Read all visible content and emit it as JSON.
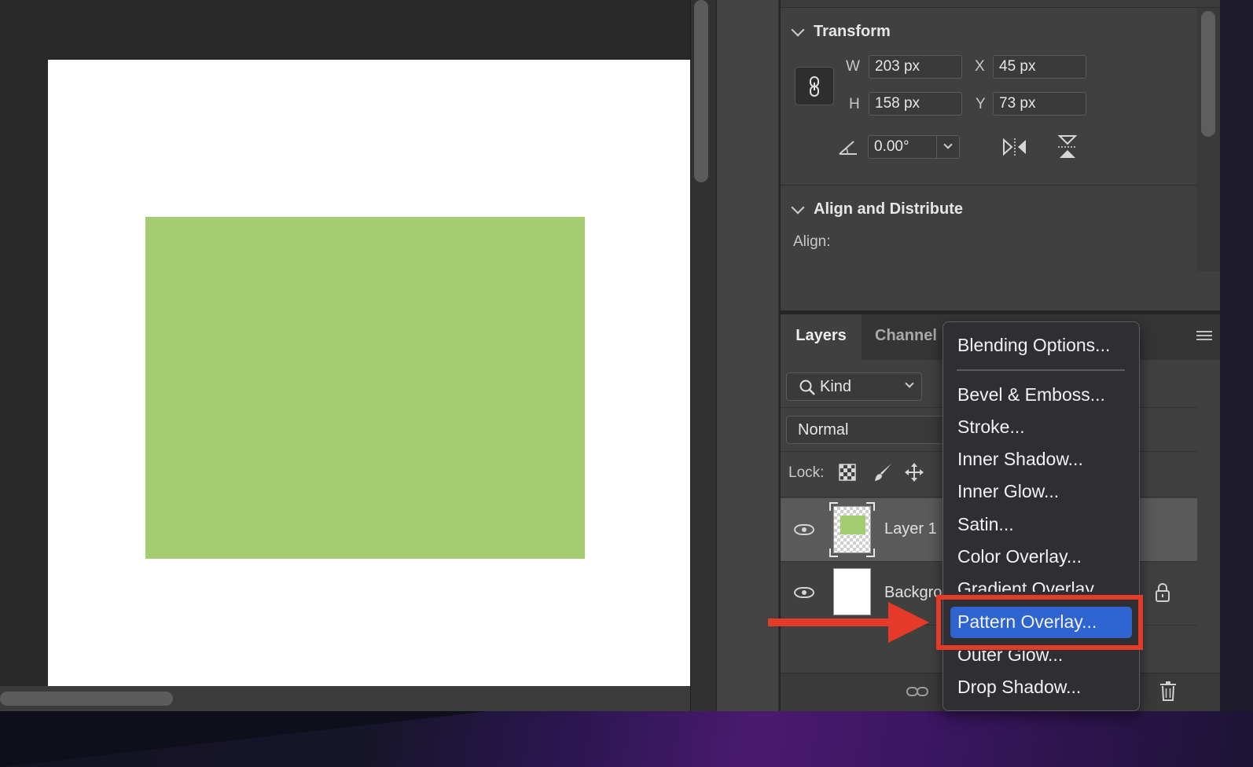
{
  "colors": {
    "layer_fill": "#a4cc71",
    "accent_red": "#e5392a",
    "menu_highlight": "#2e63d0"
  },
  "properties": {
    "transform": {
      "title": "Transform",
      "w_label": "W",
      "w_value": "203 px",
      "h_label": "H",
      "h_value": "158 px",
      "x_label": "X",
      "x_value": "45 px",
      "y_label": "Y",
      "y_value": "73 px",
      "angle_value": "0.00°"
    },
    "align": {
      "title": "Align and Distribute",
      "align_label": "Align:"
    }
  },
  "layers_panel": {
    "tabs": [
      "Layers",
      "Channel"
    ],
    "filter": "Kind",
    "blend_mode": "Normal",
    "lock_label": "Lock:",
    "layers": [
      {
        "name": "Layer 1",
        "selected": true
      },
      {
        "name": "Backgro",
        "selected": false
      }
    ]
  },
  "context_menu": {
    "items": [
      "Blending Options...",
      "Bevel & Emboss...",
      "Stroke...",
      "Inner Shadow...",
      "Inner Glow...",
      "Satin...",
      "Color Overlay...",
      "Gradient Overlay...",
      "Pattern Overlay...",
      "Outer Glow...",
      "Drop Shadow..."
    ],
    "highlighted": "Pattern Overlay..."
  }
}
